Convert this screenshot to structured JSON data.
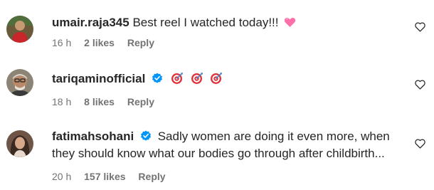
{
  "comments": [
    {
      "username": "umair.raja345",
      "verified": false,
      "text": "Best reel I watched today!!!",
      "emoji": "heart-emoji",
      "time": "16 h",
      "likes": "2 likes",
      "reply": "Reply"
    },
    {
      "username": "tariqaminofficial",
      "verified": true,
      "text": "",
      "emoji": "direct-hit-emoji",
      "time": "18 h",
      "likes": "8 likes",
      "reply": "Reply"
    },
    {
      "username": "fatimahsohani",
      "verified": true,
      "text_line1": "Sadly women are doing it even more, when",
      "text_line2": "they should know what our bodies go through after childbirth...",
      "time": "20 h",
      "likes": "157 likes",
      "reply": "Reply"
    }
  ],
  "colors": {
    "text": "#262626",
    "secondary": "#737373",
    "verified": "#0095f6",
    "heart_emoji": "#ff6fa8",
    "target_red": "#e0303a"
  }
}
